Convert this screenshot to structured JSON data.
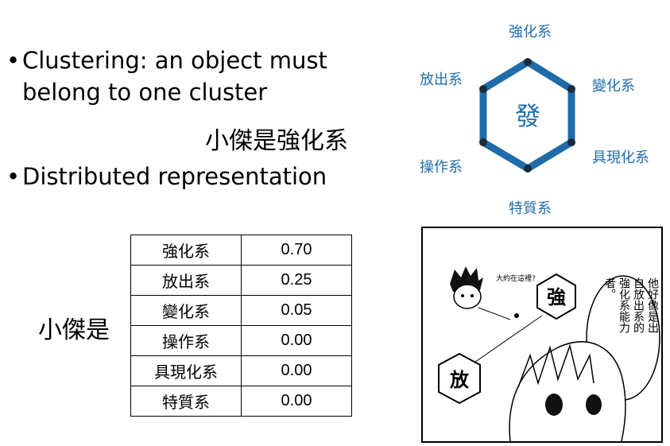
{
  "bullets": {
    "clustering_line1": "Clustering: an object must",
    "clustering_line2": "belong to one cluster",
    "distributed": "Distributed representation",
    "bullet_char": "•"
  },
  "example_sentence": "小傑是強化系",
  "table_subject": "小傑是",
  "distribution": [
    {
      "label": "強化系",
      "value": "0.70"
    },
    {
      "label": "放出系",
      "value": "0.25"
    },
    {
      "label": "變化系",
      "value": "0.05"
    },
    {
      "label": "操作系",
      "value": "0.00"
    },
    {
      "label": "具現化系",
      "value": "0.00"
    },
    {
      "label": "特質系",
      "value": "0.00"
    }
  ],
  "hexagon": {
    "center": "發",
    "top": "強化系",
    "top_right": "變化系",
    "bottom_right": "具現化系",
    "bottom": "特質系",
    "bottom_left": "操作系",
    "top_left": "放出系",
    "color": "#1f6ca8"
  },
  "comic": {
    "speech_small": "大約在這裡?",
    "tag_strong": "強",
    "tag_release": "放",
    "speech_col1": "他好像是出",
    "speech_col2": "自放出系的",
    "speech_col3": "強化系能力",
    "speech_col4": "者。"
  }
}
